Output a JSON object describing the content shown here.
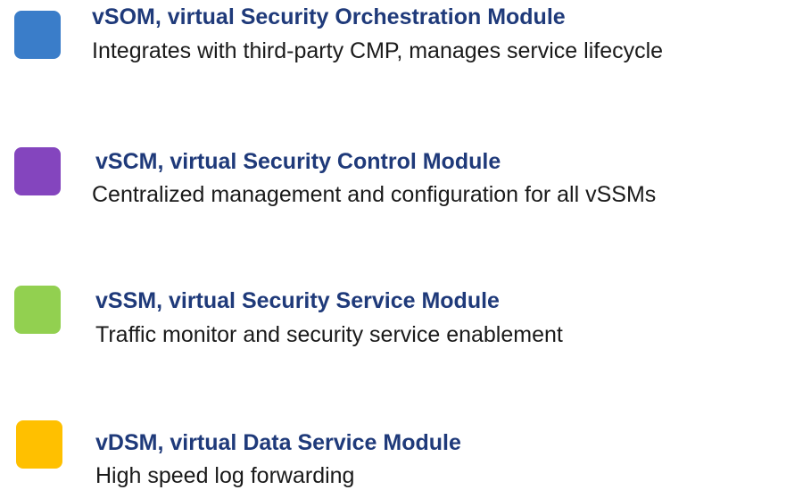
{
  "modules": [
    {
      "title": "vSOM, virtual Security Orchestration Module",
      "description": "Integrates with third-party CMP, manages service lifecycle",
      "color": "#3a7dc9"
    },
    {
      "title": "vSCM, virtual Security Control Module",
      "description": "Centralized management and configuration for all vSSMs",
      "color": "#8445be"
    },
    {
      "title": "vSSM, virtual Security Service Module",
      "description": "Traffic monitor and security service enablement",
      "color": "#92d050"
    },
    {
      "title": "vDSM, virtual Data Service Module",
      "description": "High speed log forwarding",
      "color": "#ffc000"
    }
  ]
}
